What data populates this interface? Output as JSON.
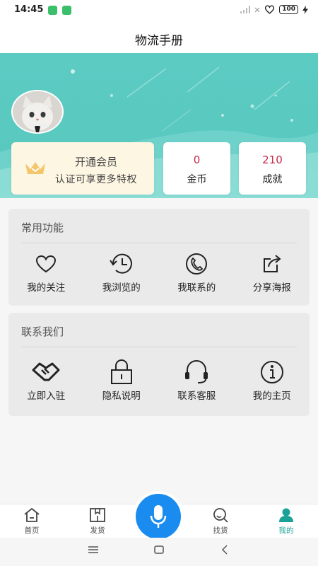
{
  "status_bar": {
    "time": "14:45",
    "battery": "100"
  },
  "header": {
    "title": "物流手册"
  },
  "vip": {
    "title": "开通会员",
    "subtitle": "认证可享更多特权"
  },
  "stats": [
    {
      "value": "0",
      "label": "金币"
    },
    {
      "value": "210",
      "label": "成就"
    }
  ],
  "common_functions": {
    "title": "常用功能",
    "items": [
      {
        "label": "我的关注",
        "icon": "heart-icon"
      },
      {
        "label": "我浏览的",
        "icon": "history-clock-icon"
      },
      {
        "label": "我联系的",
        "icon": "phone-icon"
      },
      {
        "label": "分享海报",
        "icon": "share-icon"
      }
    ]
  },
  "contact_us": {
    "title": "联系我们",
    "items": [
      {
        "label": "立即入驻",
        "icon": "handshake-icon"
      },
      {
        "label": "隐私说明",
        "icon": "lock-icon"
      },
      {
        "label": "联系客服",
        "icon": "headset-icon"
      },
      {
        "label": "我的主页",
        "icon": "info-icon"
      }
    ]
  },
  "tabbar": {
    "tabs": [
      {
        "label": "首页",
        "icon": "home-icon"
      },
      {
        "label": "发货",
        "icon": "shipping-box-icon"
      },
      {
        "label": "找货",
        "icon": "search-goods-icon"
      },
      {
        "label": "我的",
        "icon": "user-icon",
        "active": true
      }
    ],
    "center": {
      "icon": "microphone-icon"
    }
  },
  "colors": {
    "accent": "#1aa296",
    "banner": "#5ccbc2",
    "mic": "#1a8cf0",
    "stat_value": "#c62a4a",
    "vip_bg": "#fdf6e3"
  }
}
